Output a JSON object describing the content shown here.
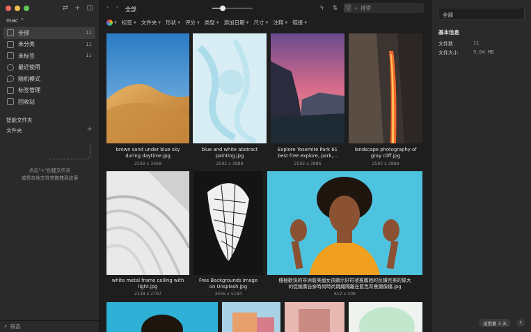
{
  "sidebar": {
    "library": "mac ⌃",
    "items": [
      {
        "label": "全部",
        "count": "11",
        "icon": "all-icon"
      },
      {
        "label": "未分类",
        "count": "11",
        "icon": "uncategorized-icon"
      },
      {
        "label": "未标签",
        "count": "11",
        "icon": "untagged-icon"
      },
      {
        "label": "最近使用",
        "count": "",
        "icon": "recent-icon"
      },
      {
        "label": "随机模式",
        "count": "",
        "icon": "random-icon"
      },
      {
        "label": "标签管理",
        "count": "",
        "icon": "tag-manage-icon"
      },
      {
        "label": "回收站",
        "count": "",
        "icon": "trash-icon"
      }
    ],
    "smart_folders": "智能文件夹",
    "folders": "文件夹",
    "hint_line1": "点击\"+\"创建文件夹",
    "hint_line2": "或将本地文件夹拖拽到这里",
    "filter": "筛选"
  },
  "toolbar": {
    "breadcrumb": "全部",
    "search_placeholder": "搜索",
    "zoom_level": 0.25
  },
  "filters": [
    "标签",
    "文件夹",
    "形状",
    "评分",
    "类型",
    "添加日期",
    "尺寸",
    "注释",
    "链接"
  ],
  "items": [
    {
      "name1": "brown sand under blue sky",
      "name2": "during daytime.jpg",
      "dim": "2592 x 3468"
    },
    {
      "name1": "blue and white abstract",
      "name2": "painting.jpg",
      "dim": "2592 x 3888"
    },
    {
      "name1": "Explore Yosemite Park 61",
      "name2": "best free explore, park,...",
      "dim": "2592 x 3886"
    },
    {
      "name1": "landscape photography of",
      "name2": "gray cliff.jpg",
      "dim": "2592 x 3888"
    },
    {
      "name1": "white metal frame ceiling with",
      "name2": "light.jpg",
      "dim": "2238 x 2797"
    },
    {
      "name1": "Free Backgrounds Image",
      "name2": "on Unsplash.jpg",
      "dim": "3456 x 5184"
    },
    {
      "name1": "穩極歡快的非洲裔美國女孩顯示好符號推薦她的反饋完美的偉大",
      "name2": "的促銷廣告穿時尚時尚跳繩隔離在藍色背景圖像檔.jpg",
      "dim": "612 x 408"
    }
  ],
  "inspector": {
    "title": "全部",
    "section": "基本信息",
    "rows": [
      {
        "k": "文件数",
        "v": "11"
      },
      {
        "k": "文件大小",
        "v": "9.04 MB"
      }
    ],
    "trial": "试用剩 3 天",
    "help": "?"
  },
  "colors": {
    "bg": "#1e1e1f",
    "sidebar": "#2a2a2b",
    "accent": "#ffffff"
  }
}
